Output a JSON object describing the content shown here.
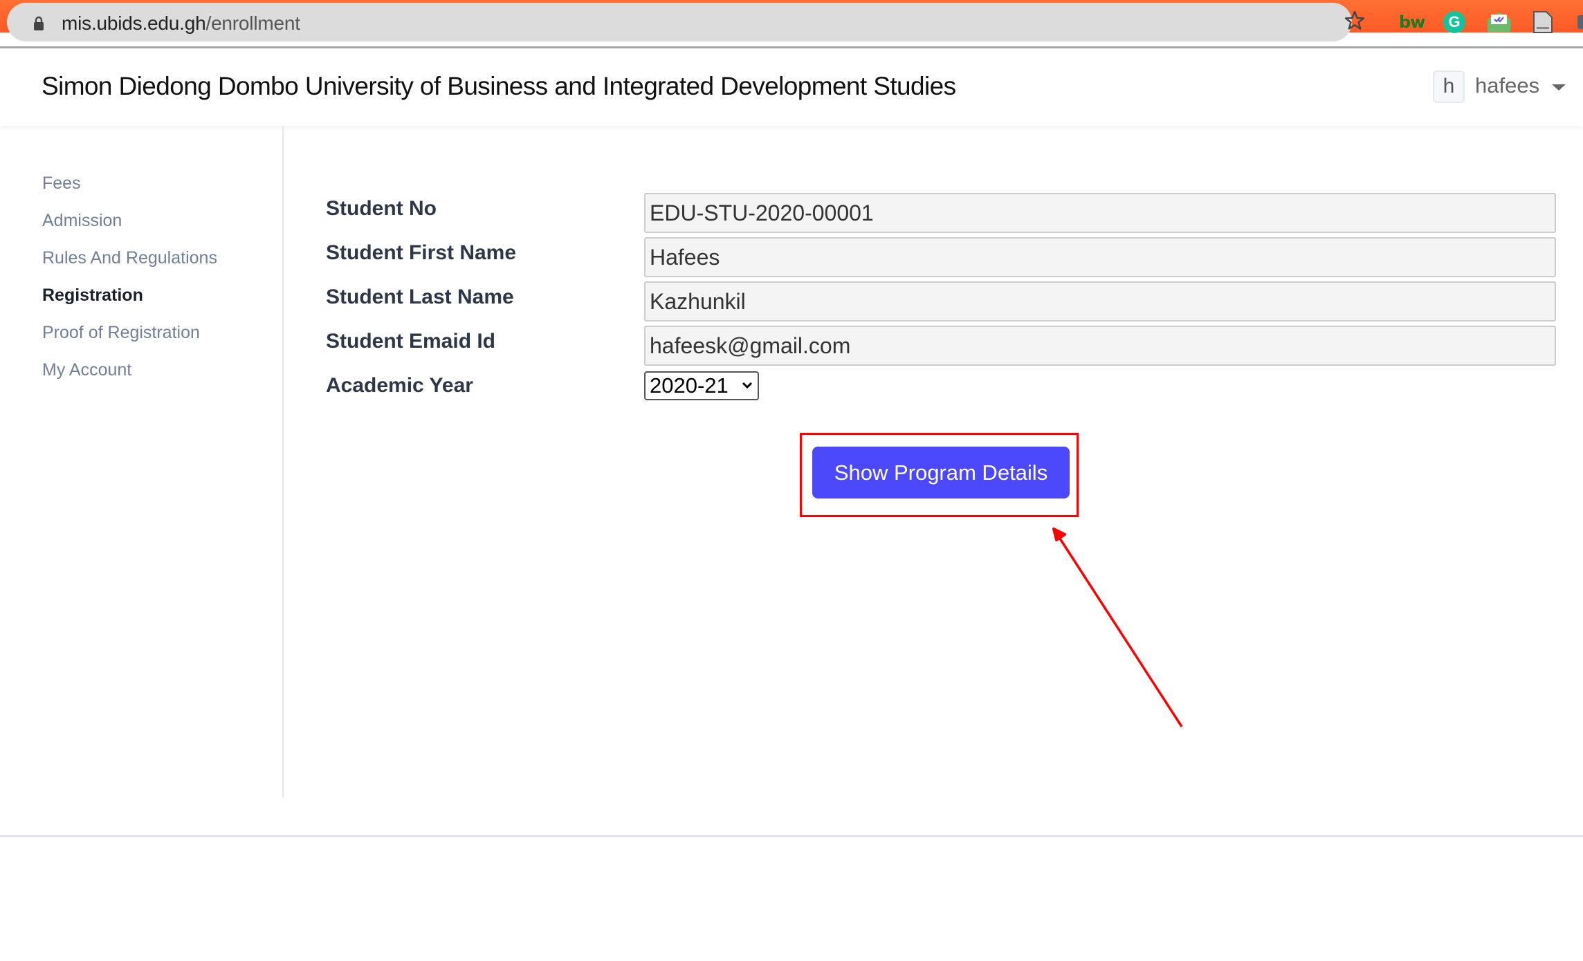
{
  "browser": {
    "url_host": "mis.ubids.edu.gh",
    "url_path": "/enrollment",
    "extensions": [
      "bw",
      "grammarly",
      "mail-tracker",
      "document",
      "puzzle"
    ],
    "grammarly_glyph": "G",
    "bw_label": "bw"
  },
  "header": {
    "title": "Simon Diedong Dombo University of Business and Integrated Development Studies",
    "user_initial": "h",
    "user_name": "hafees"
  },
  "sidebar": {
    "items": [
      {
        "label": "Fees",
        "active": false
      },
      {
        "label": "Admission",
        "active": false
      },
      {
        "label": "Rules And Regulations",
        "active": false
      },
      {
        "label": "Registration",
        "active": true
      },
      {
        "label": "Proof of Registration",
        "active": false
      },
      {
        "label": "My Account",
        "active": false
      }
    ]
  },
  "form": {
    "fields": [
      {
        "label": "Student No",
        "value": "EDU-STU-2020-00001"
      },
      {
        "label": "Student First Name",
        "value": "Hafees"
      },
      {
        "label": "Student Last Name",
        "value": "Kazhunkil"
      },
      {
        "label": "Student Emaid Id",
        "value": "hafeesk@gmail.com"
      }
    ],
    "academic_year_label": "Academic Year",
    "academic_year_value": "2020-21",
    "submit_label": "Show Program Details"
  },
  "colors": {
    "primary_button": "#4b49fb",
    "annotation": "#ff0000",
    "sidebar_text": "#718096",
    "chrome_accent": "#ff5a26"
  }
}
